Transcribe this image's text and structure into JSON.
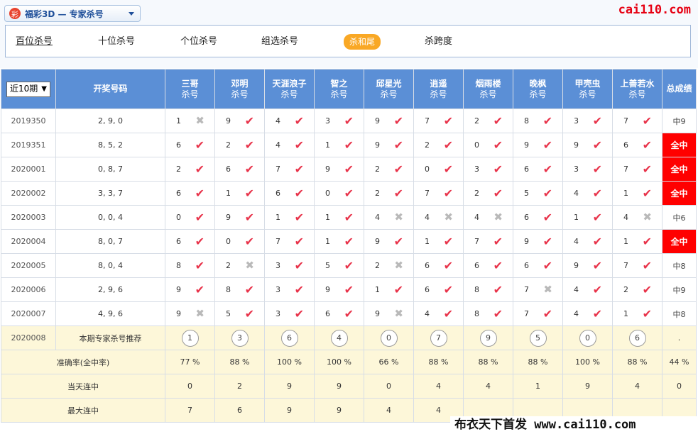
{
  "header": {
    "dropdown_logo": "彩",
    "dropdown_label": "福彩3D — 专家杀号",
    "brand": "cai110.com"
  },
  "tabs": [
    "百位杀号",
    "十位杀号",
    "个位杀号",
    "组选杀号",
    "杀和尾",
    "杀跨度"
  ],
  "active_tab": "杀和尾",
  "period_select": "近10期",
  "columns": {
    "winning": "开奖号码",
    "total": "总成绩",
    "experts": [
      {
        "name": "三哥",
        "sub": "杀号"
      },
      {
        "name": "邓明",
        "sub": "杀号"
      },
      {
        "name": "天涯浪子",
        "sub": "杀号"
      },
      {
        "name": "智之",
        "sub": "杀号"
      },
      {
        "name": "邱星光",
        "sub": "杀号"
      },
      {
        "name": "逍遥",
        "sub": "杀号"
      },
      {
        "name": "烟雨楼",
        "sub": "杀号"
      },
      {
        "name": "晚枫",
        "sub": "杀号"
      },
      {
        "name": "甲壳虫",
        "sub": "杀号"
      },
      {
        "name": "上善若水",
        "sub": "杀号"
      }
    ]
  },
  "rows": [
    {
      "issue": "2019350",
      "winning": "2, 9, 0",
      "picks": [
        "1",
        "9",
        "4",
        "3",
        "9",
        "7",
        "2",
        "8",
        "3",
        "7"
      ],
      "hits": [
        0,
        1,
        1,
        1,
        1,
        1,
        1,
        1,
        1,
        1
      ],
      "total": "中9",
      "full": false
    },
    {
      "issue": "2019351",
      "winning": "8, 5, 2",
      "picks": [
        "6",
        "2",
        "4",
        "1",
        "9",
        "2",
        "0",
        "9",
        "9",
        "6"
      ],
      "hits": [
        1,
        1,
        1,
        1,
        1,
        1,
        1,
        1,
        1,
        1
      ],
      "total": "全中",
      "full": true
    },
    {
      "issue": "2020001",
      "winning": "0, 8, 7",
      "picks": [
        "2",
        "6",
        "7",
        "9",
        "2",
        "0",
        "3",
        "6",
        "3",
        "7"
      ],
      "hits": [
        1,
        1,
        1,
        1,
        1,
        1,
        1,
        1,
        1,
        1
      ],
      "total": "全中",
      "full": true
    },
    {
      "issue": "2020002",
      "winning": "3, 3, 7",
      "picks": [
        "6",
        "1",
        "6",
        "0",
        "2",
        "7",
        "2",
        "5",
        "4",
        "1"
      ],
      "hits": [
        1,
        1,
        1,
        1,
        1,
        1,
        1,
        1,
        1,
        1
      ],
      "total": "全中",
      "full": true
    },
    {
      "issue": "2020003",
      "winning": "0, 0, 4",
      "picks": [
        "0",
        "9",
        "1",
        "1",
        "4",
        "4",
        "4",
        "6",
        "1",
        "4"
      ],
      "hits": [
        1,
        1,
        1,
        1,
        0,
        0,
        0,
        1,
        1,
        0
      ],
      "total": "中6",
      "full": false
    },
    {
      "issue": "2020004",
      "winning": "8, 0, 7",
      "picks": [
        "6",
        "0",
        "7",
        "1",
        "9",
        "1",
        "7",
        "9",
        "4",
        "1"
      ],
      "hits": [
        1,
        1,
        1,
        1,
        1,
        1,
        1,
        1,
        1,
        1
      ],
      "total": "全中",
      "full": true
    },
    {
      "issue": "2020005",
      "winning": "8, 0, 4",
      "picks": [
        "8",
        "2",
        "3",
        "5",
        "2",
        "6",
        "6",
        "6",
        "9",
        "7"
      ],
      "hits": [
        1,
        0,
        1,
        1,
        0,
        1,
        1,
        1,
        1,
        1
      ],
      "total": "中8",
      "full": false
    },
    {
      "issue": "2020006",
      "winning": "2, 9, 6",
      "picks": [
        "9",
        "8",
        "3",
        "9",
        "1",
        "6",
        "8",
        "7",
        "4",
        "2"
      ],
      "hits": [
        1,
        1,
        1,
        1,
        1,
        1,
        1,
        0,
        1,
        1
      ],
      "total": "中9",
      "full": false
    },
    {
      "issue": "2020007",
      "winning": "4, 9, 6",
      "picks": [
        "9",
        "5",
        "3",
        "6",
        "9",
        "4",
        "8",
        "7",
        "4",
        "1"
      ],
      "hits": [
        0,
        1,
        1,
        1,
        0,
        1,
        1,
        1,
        1,
        1
      ],
      "total": "中8",
      "full": false
    }
  ],
  "recommend": {
    "issue": "2020008",
    "label": "本期专家杀号推荐",
    "picks": [
      "1",
      "3",
      "6",
      "4",
      "0",
      "7",
      "9",
      "5",
      "0",
      "6"
    ],
    "total": "."
  },
  "stats": [
    {
      "label": "准确率(全中率)",
      "values": [
        "77 %",
        "88 %",
        "100 %",
        "100 %",
        "66 %",
        "88 %",
        "88 %",
        "88 %",
        "100 %",
        "88 %"
      ],
      "total": "44 %"
    },
    {
      "label": "当天连中",
      "values": [
        "0",
        "2",
        "9",
        "9",
        "0",
        "4",
        "4",
        "1",
        "9",
        "4"
      ],
      "total": "0"
    },
    {
      "label": "最大连中",
      "values": [
        "7",
        "6",
        "9",
        "9",
        "4",
        "4",
        "",
        "",
        "",
        ""
      ],
      "total": ""
    }
  ],
  "watermark": "布衣天下首发 www.cai110.com",
  "icons": {
    "hit": "check-icon",
    "miss": "cross-icon"
  },
  "colors": {
    "header_bg": "#5b8fd6",
    "hit": "#e8334a",
    "full_bg": "#ff0000",
    "active_tab": "#f9a825",
    "recommend_bg": "#fdf7d9"
  }
}
